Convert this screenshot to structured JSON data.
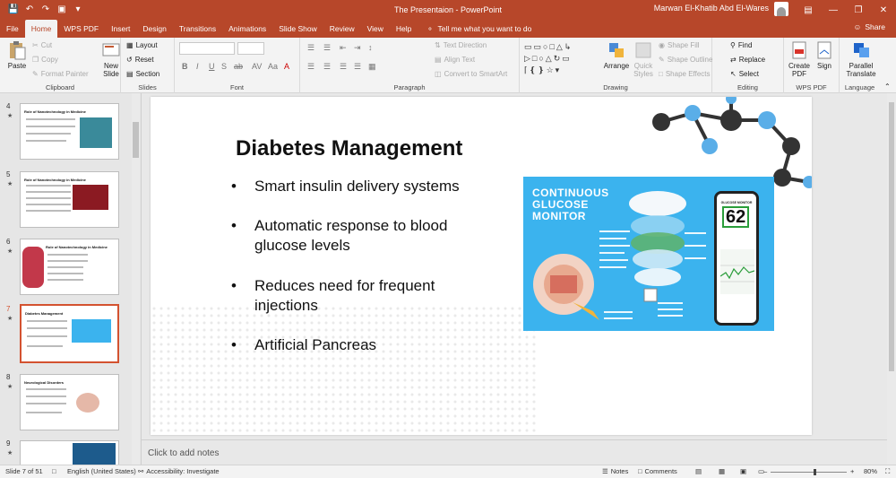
{
  "window": {
    "title": "The Presentaion  -  PowerPoint",
    "user": "Marwan El-Khatib Abd El-Wares"
  },
  "tabs": [
    {
      "label": "File"
    },
    {
      "label": "Home"
    },
    {
      "label": "WPS PDF"
    },
    {
      "label": "Insert"
    },
    {
      "label": "Design"
    },
    {
      "label": "Transitions"
    },
    {
      "label": "Animations"
    },
    {
      "label": "Slide Show"
    },
    {
      "label": "Review"
    },
    {
      "label": "View"
    },
    {
      "label": "Help"
    }
  ],
  "tell_me": "Tell me what you want to do",
  "share": "Share",
  "ribbon": {
    "clipboard": {
      "label": "Clipboard",
      "paste": "Paste",
      "cut": "Cut",
      "copy": "Copy",
      "format_painter": "Format Painter"
    },
    "slides": {
      "label": "Slides",
      "new_slide": "New Slide",
      "layout": "Layout",
      "reset": "Reset",
      "section": "Section"
    },
    "font": {
      "label": "Font"
    },
    "paragraph": {
      "label": "Paragraph",
      "text_direction": "Text Direction",
      "align_text": "Align Text",
      "convert_smartart": "Convert to SmartArt"
    },
    "drawing": {
      "label": "Drawing",
      "arrange": "Arrange",
      "quick_styles": "Quick Styles",
      "shape_fill": "Shape Fill",
      "shape_outline": "Shape Outline",
      "shape_effects": "Shape Effects"
    },
    "editing": {
      "label": "Editing",
      "find": "Find",
      "replace": "Replace",
      "select": "Select"
    },
    "wps": {
      "label": "WPS PDF",
      "create_pdf": "Create PDF",
      "sign": "Sign"
    },
    "language": {
      "label": "Language",
      "parallel_translate": "Parallel Translate"
    }
  },
  "thumbnails": [
    {
      "number": "4",
      "title": "Role of Nanotechnology in Medicine"
    },
    {
      "number": "5",
      "title": "Role of Nanotechnology in Medicine"
    },
    {
      "number": "6",
      "title": "Role of Nanotechnology in Medicine"
    },
    {
      "number": "7",
      "title": "Diabetes Management"
    },
    {
      "number": "8",
      "title": "Neurological Disorders"
    },
    {
      "number": "9",
      "title": ""
    }
  ],
  "slide": {
    "title": "Diabetes Management",
    "bullets": [
      {
        "lines": [
          "Smart insulin delivery systems"
        ]
      },
      {
        "lines": [
          "Automatic response to blood",
          "glucose levels"
        ]
      },
      {
        "lines": [
          "Reduces need for frequent",
          "injections"
        ]
      },
      {
        "lines": [
          "Artificial Pancreas"
        ]
      }
    ],
    "image": {
      "title_line1": "CONTINUOUS",
      "title_line2": "GLUCOSE",
      "title_line3": "MONITOR",
      "phone_label": "GLUCOSE MONITOR",
      "reading": "62"
    }
  },
  "notes_placeholder": "Click to add notes",
  "status": {
    "slide_count": "Slide 7 of 51",
    "language": "English (United States)",
    "accessibility": "Accessibility: Investigate",
    "notes": "Notes",
    "comments": "Comments",
    "zoom": "80%",
    "zoom_fraction": 0.57
  },
  "colors": {
    "accent": "#b7472a",
    "selection": "#d35230",
    "infographic": "#3bb3ee"
  }
}
